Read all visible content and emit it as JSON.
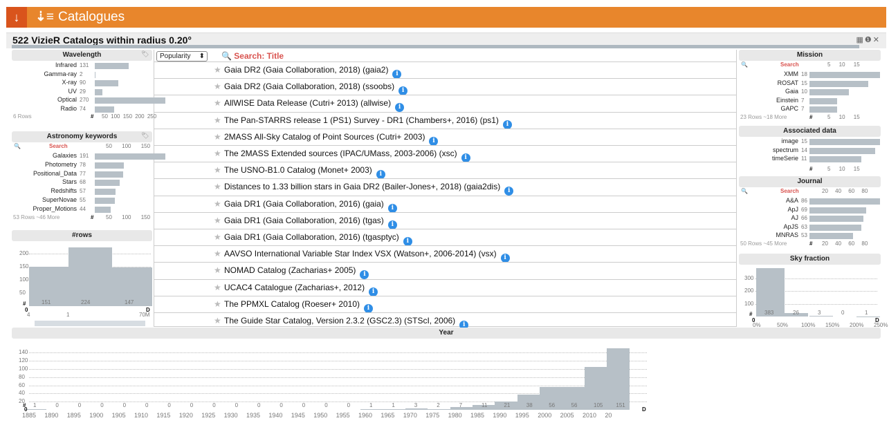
{
  "topbar": {
    "icon": "arrow-down-icon",
    "sort_icon": "sort-icon",
    "title": "Catalogues"
  },
  "main_title": "522 VizieR Catalogs within radius 0.20°",
  "toolbar_icons": "▦❶✕",
  "sort": {
    "selected": "Popularity",
    "arrow": "⬍"
  },
  "search_title": "Search: Title",
  "catalogs": [
    "Gaia DR2 (Gaia Collaboration, 2018) (gaia2)",
    "Gaia DR2 (Gaia Collaboration, 2018) (ssoobs)",
    "AllWISE Data Release (Cutri+ 2013) (allwise)",
    "The Pan-STARRS release 1 (PS1) Survey - DR1 (Chambers+, 2016) (ps1)",
    "2MASS All-Sky Catalog of Point Sources (Cutri+ 2003)",
    "The 2MASS Extended sources (IPAC/UMass, 2003-2006) (xsc)",
    "The USNO-B1.0 Catalog (Monet+ 2003)",
    "Distances to 1.33 billion stars in Gaia DR2 (Bailer-Jones+, 2018) (gaia2dis)",
    "Gaia DR1 (Gaia Collaboration, 2016) (gaia)",
    "Gaia DR1 (Gaia Collaboration, 2016) (tgas)",
    "Gaia DR1 (Gaia Collaboration, 2016) (tgasptyc)",
    "AAVSO International Variable Star Index VSX (Watson+, 2006-2014) (vsx)",
    "NOMAD Catalog (Zacharias+ 2005)",
    "UCAC4 Catalogue (Zacharias+, 2012)",
    "The PPMXL Catalog (Roeser+ 2010)",
    "The Guide Star Catalog, Version 2.3.2 (GSC2.3) (STScI, 2006)"
  ],
  "info_glyph": "i",
  "star_glyph": "★",
  "wavelength": {
    "title": "Wavelength",
    "rows": [
      {
        "label": "Infrared",
        "count": "131",
        "value": 131
      },
      {
        "label": "Gamma-ray",
        "count": "2",
        "value": 2
      },
      {
        "label": "X-ray",
        "count": "90",
        "value": 90
      },
      {
        "label": "UV",
        "count": "29",
        "value": 29
      },
      {
        "label": "Optical",
        "count": "270",
        "value": 270
      },
      {
        "label": "Radio",
        "count": "74",
        "value": 74
      }
    ],
    "footer": "6 Rows",
    "hash": "#",
    "ticks": "50 100 150 200 250"
  },
  "keywords": {
    "title": "Astronomy keywords",
    "search": "Search",
    "ticks_top": "50 100 150",
    "rows": [
      {
        "label": "Galaxies",
        "count": "191",
        "value": 191
      },
      {
        "label": "Photometry",
        "count": "78",
        "value": 78
      },
      {
        "label": "Positional_Data",
        "count": "77",
        "value": 77
      },
      {
        "label": "Stars",
        "count": "68",
        "value": 68
      },
      {
        "label": "Redshifts",
        "count": "57",
        "value": 57
      },
      {
        "label": "SuperNovae",
        "count": "55",
        "value": 55
      },
      {
        "label": "Proper_Motions",
        "count": "44",
        "value": 44
      }
    ],
    "footer": "53 Rows ~46 More",
    "hash": "#",
    "ticks": "50 100 150"
  },
  "nrows": {
    "title": "#rows",
    "yticks": [
      "200",
      "150",
      "100",
      "50"
    ],
    "bars": [
      {
        "label": "151",
        "value": 151
      },
      {
        "label": "224",
        "value": 224
      },
      {
        "label": "147",
        "value": 147
      }
    ],
    "hash": "#",
    "zero": "0",
    "x0": "4",
    "x1": "1",
    "x2": "70M",
    "d": "D"
  },
  "mission": {
    "title": "Mission",
    "search": "Search",
    "ticks_top": "5 10 15",
    "rows": [
      {
        "label": "XMM",
        "count": "18",
        "value": 18
      },
      {
        "label": "ROSAT",
        "count": "15",
        "value": 15
      },
      {
        "label": "Gaia",
        "count": "10",
        "value": 10
      },
      {
        "label": "Einstein",
        "count": "7",
        "value": 7
      },
      {
        "label": "GAPC",
        "count": "7",
        "value": 7
      }
    ],
    "footer": "23 Rows ~18 More",
    "hash": "#",
    "ticks": "5 10 15"
  },
  "assoc": {
    "title": "Associated data",
    "rows": [
      {
        "label": "image",
        "count": "15",
        "value": 15
      },
      {
        "label": "spectrum",
        "count": "14",
        "value": 14
      },
      {
        "label": "timeSerie",
        "count": "11",
        "value": 11
      }
    ],
    "hash": "#",
    "ticks": "5 10 15"
  },
  "journal": {
    "title": "Journal",
    "search": "Search",
    "ticks_top": "20 40 60 80",
    "rows": [
      {
        "label": "A&A",
        "count": "86",
        "value": 86
      },
      {
        "label": "ApJ",
        "count": "69",
        "value": 69
      },
      {
        "label": "AJ",
        "count": "66",
        "value": 66
      },
      {
        "label": "ApJS",
        "count": "63",
        "value": 63
      },
      {
        "label": "MNRAS",
        "count": "53",
        "value": 53
      }
    ],
    "footer": "50 Rows ~45 More",
    "hash": "#",
    "ticks": "20 40 60 80"
  },
  "sky": {
    "title": "Sky fraction",
    "yticks": [
      "300",
      "200",
      "100"
    ],
    "bars": [
      {
        "label": "383",
        "value": 383
      },
      {
        "label": "26",
        "value": 26
      },
      {
        "label": "3",
        "value": 3
      },
      {
        "label": "0",
        "value": 0
      },
      {
        "label": "1",
        "value": 1
      }
    ],
    "hash": "#",
    "zero": "0",
    "d": "D",
    "xticks": [
      "0%",
      "50%",
      "100%",
      "150%",
      "200%",
      "250%"
    ]
  },
  "year": {
    "title": "Year",
    "yticks": [
      "140",
      "120",
      "100",
      "80",
      "60",
      "40",
      "20"
    ],
    "hash": "#",
    "zero": "0",
    "d": "D",
    "counts": [
      1,
      0,
      0,
      0,
      0,
      0,
      0,
      0,
      0,
      0,
      0,
      0,
      0,
      0,
      0,
      1,
      1,
      3,
      2,
      7,
      11,
      21,
      38,
      56,
      56,
      105,
      151
    ],
    "xticks": [
      "1885",
      "1890",
      "1895",
      "1900",
      "1905",
      "1910",
      "1915",
      "1920",
      "1925",
      "1930",
      "1935",
      "1940",
      "1945",
      "1950",
      "1955",
      "1960",
      "1965",
      "1970",
      "1975",
      "1980",
      "1985",
      "1990",
      "1995",
      "2000",
      "2005",
      "2010",
      "20"
    ]
  },
  "colors": {
    "orange": "#e8862c",
    "red": "#d9541c",
    "bar": "#b7c0c7",
    "info": "#2f8ee6",
    "search": "#d9534f"
  }
}
